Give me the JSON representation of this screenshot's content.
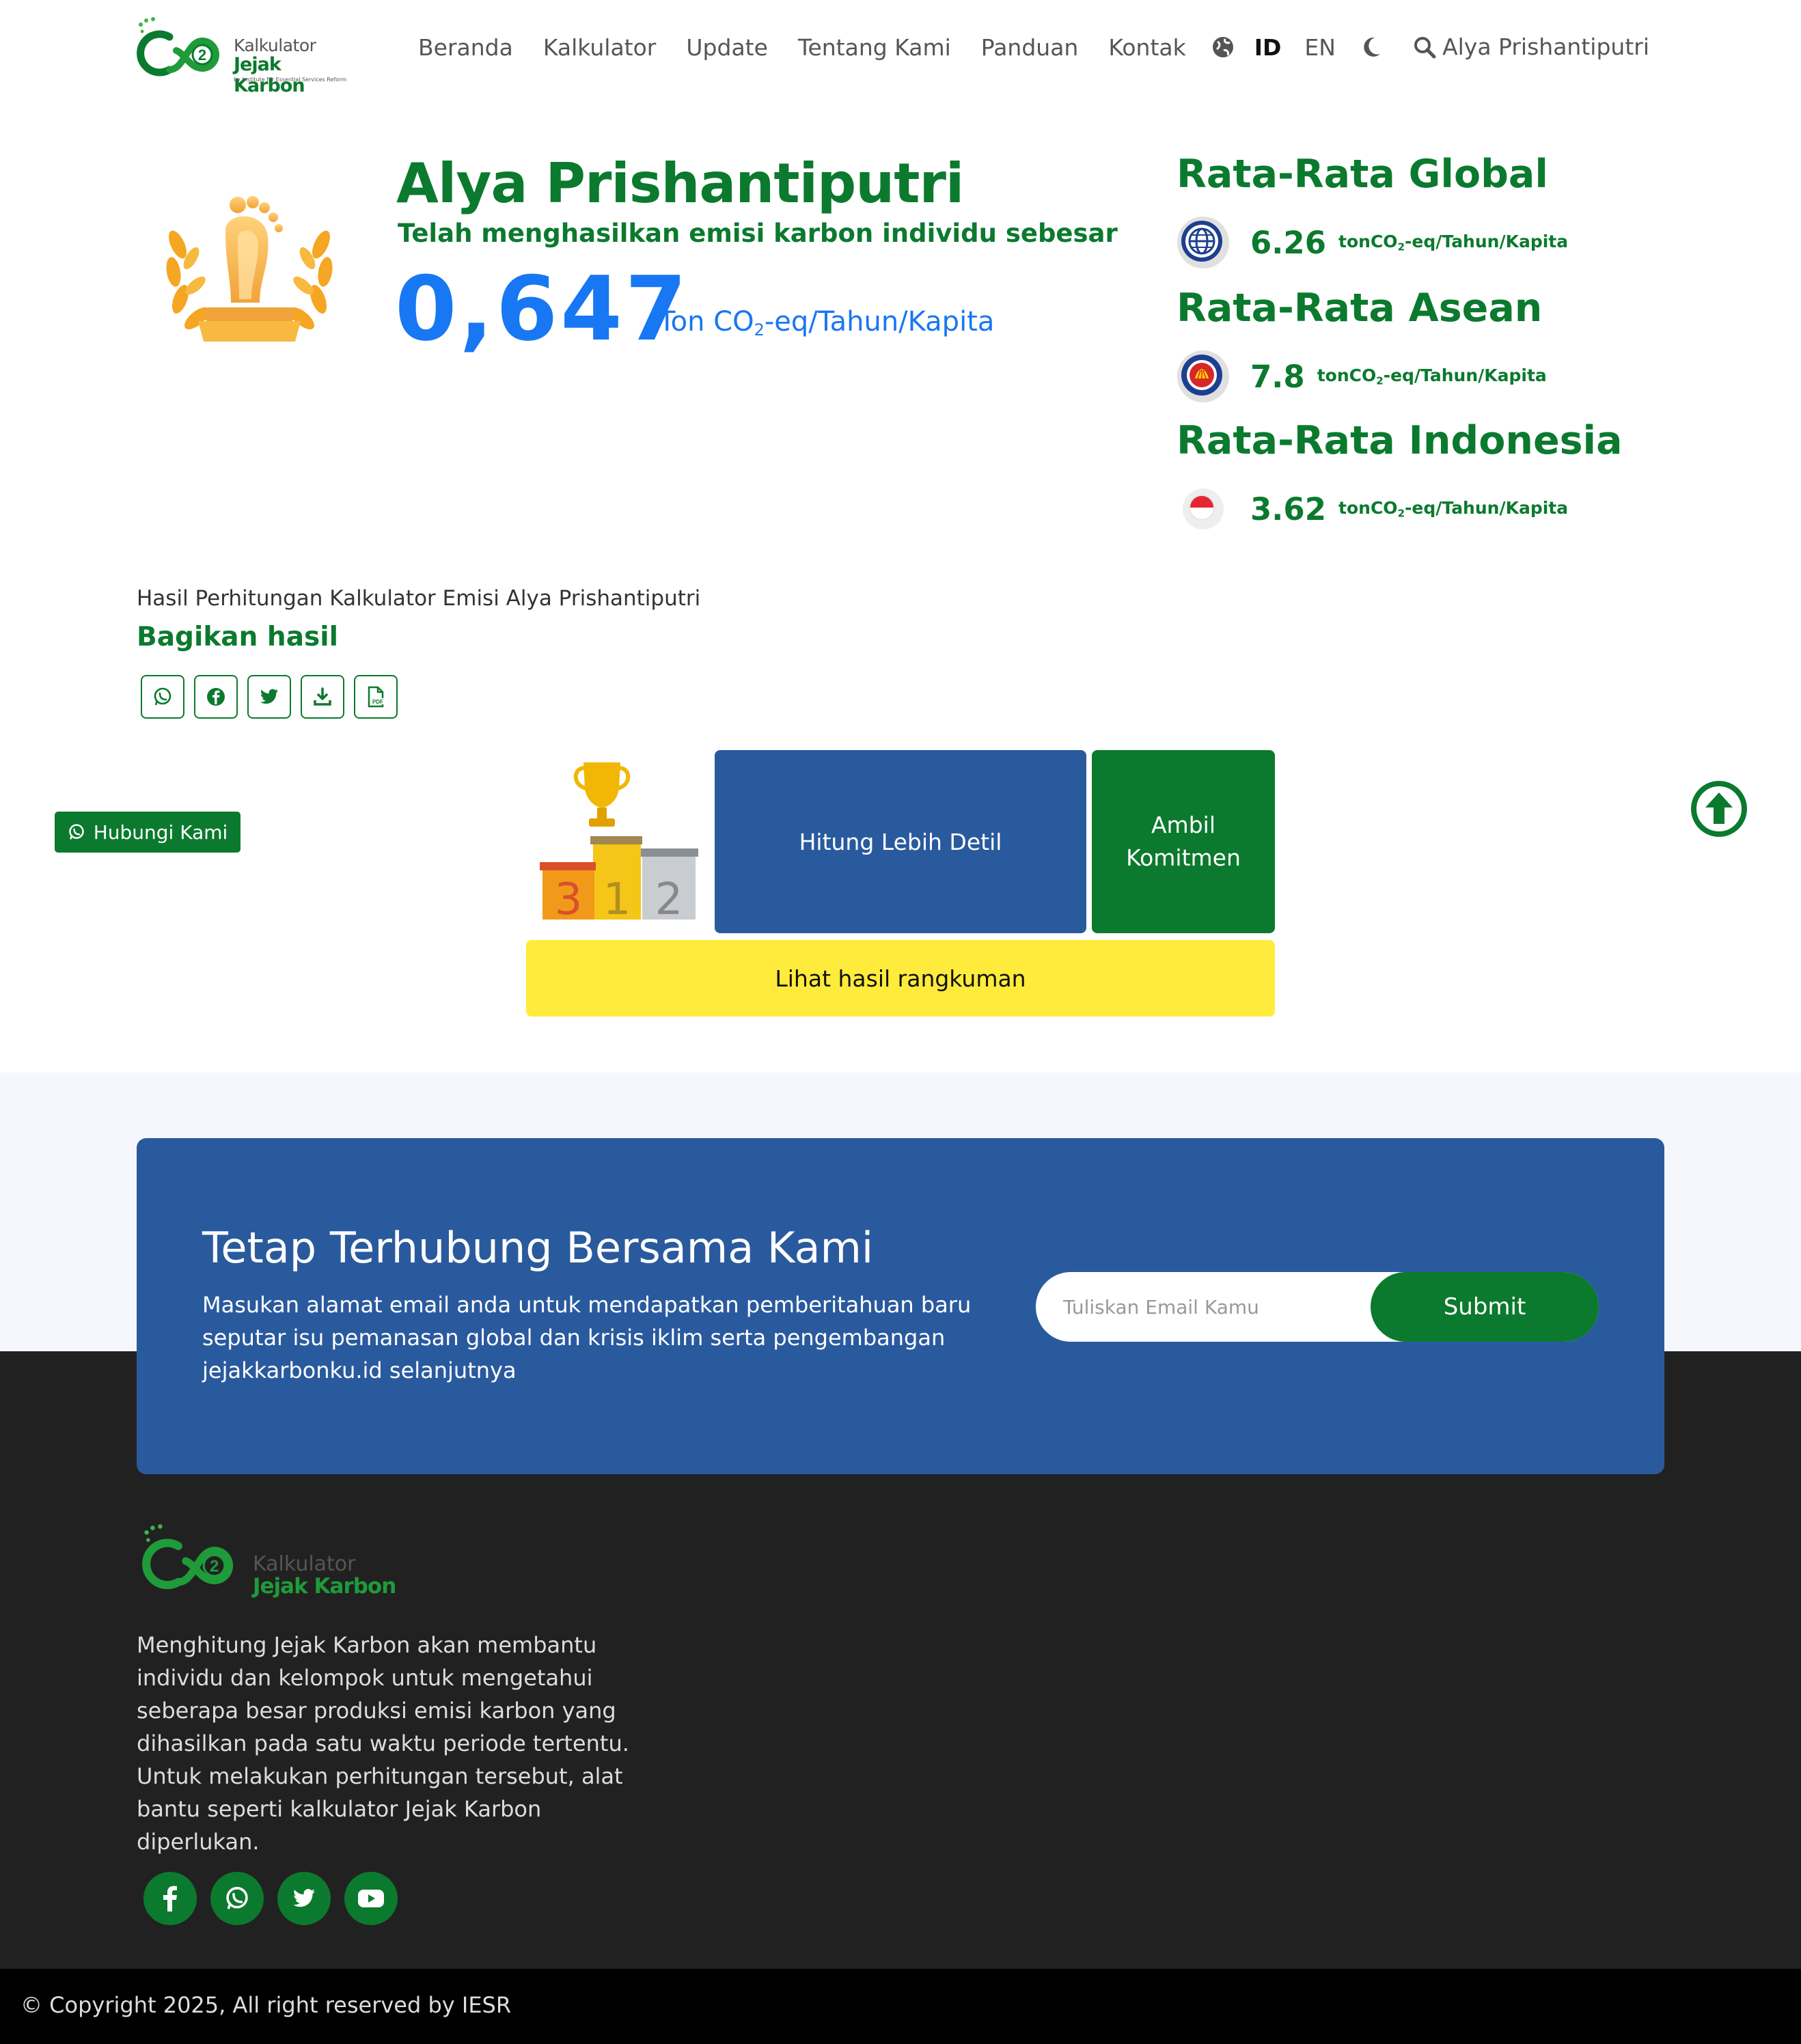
{
  "header": {
    "logo_line1": "Kalkulator",
    "logo_line2": "Jejak Karbon",
    "logo_tagline": "by Institute for Essential Services Reform",
    "nav": [
      "Beranda",
      "Kalkulator",
      "Update",
      "Tentang Kami",
      "Panduan",
      "Kontak"
    ],
    "lang_active": "ID",
    "lang_other": "EN",
    "user": "Alya Prishantiputri",
    "icons": [
      "globe-icon",
      "moon-icon",
      "search-icon"
    ]
  },
  "result": {
    "name": "Alya Prishantiputri",
    "subtitle": "Telah menghasilkan emisi karbon individu sebesar",
    "value": "0,647",
    "unit_prefix": "Ton CO",
    "unit_sub": "2",
    "unit_suffix": "-eq/Tahun/Kapita"
  },
  "averages": [
    {
      "title": "Rata-Rata Global",
      "value": "6.26",
      "unit_prefix": "tonCO",
      "unit_sub": "2",
      "unit_suffix": "-eq/Tahun/Kapita",
      "icon": "globe-flag-icon"
    },
    {
      "title": "Rata-Rata Asean",
      "value": "7.8",
      "unit_prefix": "tonCO",
      "unit_sub": "2",
      "unit_suffix": "-eq/Tahun/Kapita",
      "icon": "asean-flag-icon"
    },
    {
      "title": "Rata-Rata Indonesia",
      "value": "3.62",
      "unit_prefix": "tonCO",
      "unit_sub": "2",
      "unit_suffix": "-eq/Tahun/Kapita",
      "icon": "indonesia-flag-icon"
    }
  ],
  "share": {
    "caption": "Hasil Perhitungan Kalkulator Emisi Alya Prishantiputri",
    "title": "Bagikan hasil",
    "buttons": [
      "whatsapp-icon",
      "facebook-icon",
      "twitter-icon",
      "download-icon",
      "pdf-icon"
    ]
  },
  "contact_float": "Hubungi Kami",
  "actions": {
    "detail": "Hitung Lebih Detil",
    "commit": "Ambil Komitmen",
    "summary": "Lihat hasil rangkuman",
    "podium_numbers": [
      "3",
      "1",
      "2"
    ]
  },
  "newsletter": {
    "title": "Tetap Terhubung Bersama Kami",
    "desc": "Masukan alamat email anda untuk mendapatkan pemberitahuan baru seputar isu pemanasan global dan krisis iklim serta pengembangan jejakkarbonku.id selanjutnya",
    "placeholder": "Tuliskan Email Kamu",
    "submit": "Submit"
  },
  "footer": {
    "logo_line1": "Kalkulator",
    "logo_line2": "Jejak Karbon",
    "desc": "Menghitung Jejak Karbon akan membantu individu dan kelompok untuk mengetahui seberapa besar produksi emisi karbon yang dihasilkan pada satu waktu periode tertentu. Untuk melakukan perhitungan tersebut, alat bantu seperti kalkulator Jejak Karbon diperlukan.",
    "social": [
      "facebook-icon",
      "whatsapp-icon",
      "twitter-icon",
      "youtube-icon"
    ],
    "copyright": "© Copyright 2025, All right reserved by IESR"
  },
  "colors": {
    "brand_green": "#0b7a2e",
    "accent_blue": "#1877f2",
    "card_blue": "#2a5a9e",
    "summary_yellow": "#ffeb3b",
    "footer_dark": "#212121"
  }
}
